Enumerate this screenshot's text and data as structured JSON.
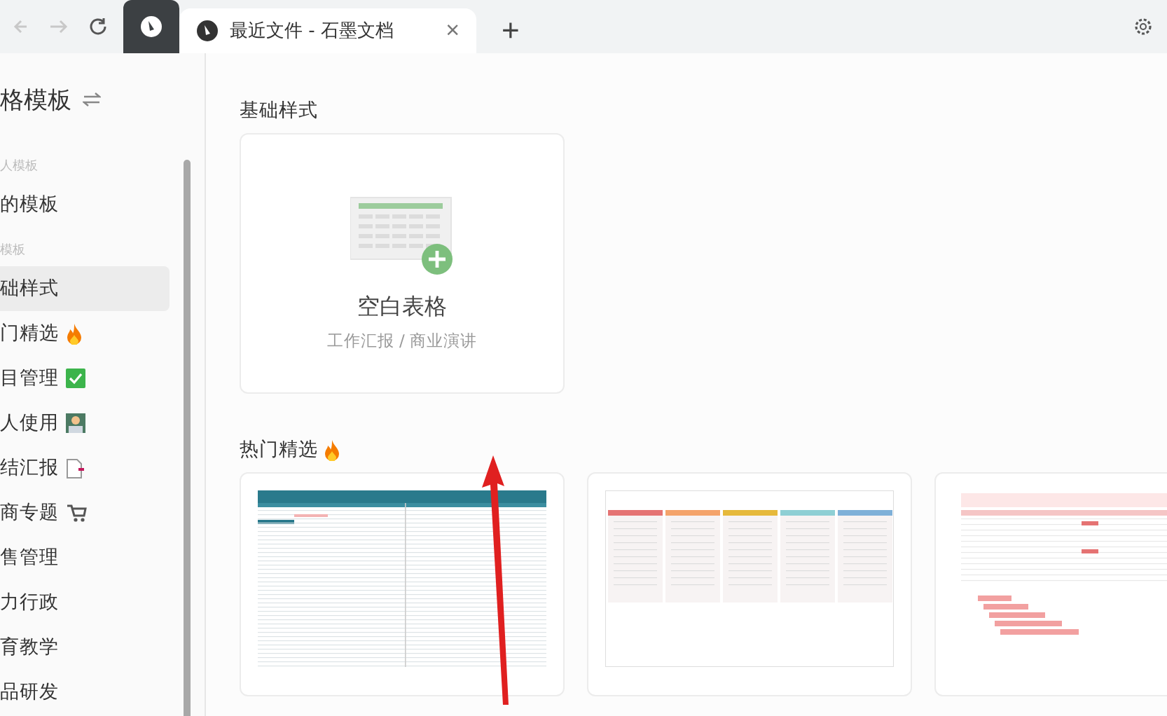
{
  "browser": {
    "tab_title": "最近文件 - 石墨文档",
    "close": "×",
    "new_tab": "+"
  },
  "sidebar": {
    "title": "格模板",
    "sections": [
      {
        "label": "人模板",
        "items": [
          {
            "label": "的模板",
            "selected": false,
            "kind": "plain"
          }
        ]
      },
      {
        "label": "模板",
        "items": [
          {
            "label": "础样式",
            "selected": true,
            "kind": "plain"
          },
          {
            "label": "门精选",
            "selected": false,
            "kind": "fire"
          },
          {
            "label": "目管理",
            "selected": false,
            "kind": "check"
          },
          {
            "label": "人使用",
            "selected": false,
            "kind": "person"
          },
          {
            "label": "结汇报",
            "selected": false,
            "kind": "document"
          },
          {
            "label": "商专题",
            "selected": false,
            "kind": "cart"
          },
          {
            "label": "售管理",
            "selected": false,
            "kind": "plain"
          },
          {
            "label": "力行政",
            "selected": false,
            "kind": "plain"
          },
          {
            "label": "育教学",
            "selected": false,
            "kind": "plain"
          },
          {
            "label": "品研发",
            "selected": false,
            "kind": "plain"
          }
        ]
      }
    ]
  },
  "main": {
    "basic": {
      "heading": "基础样式",
      "card": {
        "title": "空白表格",
        "subtitle": "工作汇报 / 商业演讲"
      }
    },
    "hot": {
      "heading": "热门精选",
      "templates": [
        {
          "kind": "list"
        },
        {
          "kind": "kanban"
        },
        {
          "kind": "gantt"
        }
      ]
    }
  }
}
